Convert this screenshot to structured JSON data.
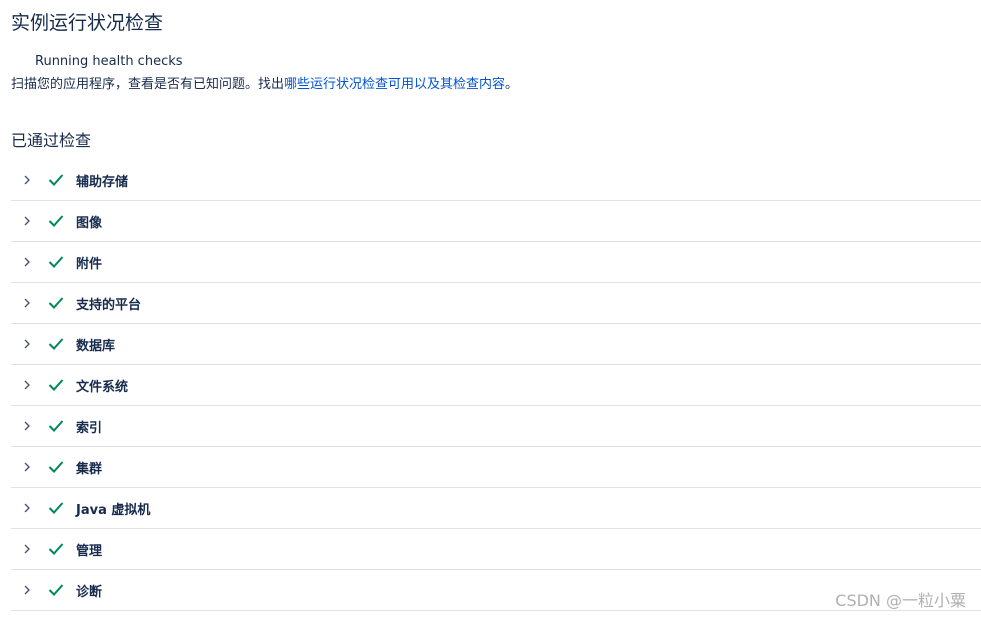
{
  "page": {
    "title": "实例运行状况检查",
    "running_text": "Running health checks",
    "description_prefix": "扫描您的应用程序，查看是否有已知问题。找出",
    "description_link": "哪些运行状况检查可用以及其检查内容",
    "description_suffix": "。"
  },
  "passed_section": {
    "title": "已通过检查",
    "items": [
      {
        "label": "辅助存储",
        "status": "passed"
      },
      {
        "label": "图像",
        "status": "passed"
      },
      {
        "label": "附件",
        "status": "passed"
      },
      {
        "label": "支持的平台",
        "status": "passed"
      },
      {
        "label": "数据库",
        "status": "passed"
      },
      {
        "label": "文件系统",
        "status": "passed"
      },
      {
        "label": "索引",
        "status": "passed"
      },
      {
        "label": "集群",
        "status": "passed"
      },
      {
        "label": "Java 虚拟机",
        "status": "passed"
      },
      {
        "label": "管理",
        "status": "passed"
      },
      {
        "label": "诊断",
        "status": "passed"
      }
    ]
  },
  "icons": {
    "expand": "chevron-right-icon",
    "status": "check-icon"
  },
  "colors": {
    "success": "#00875a",
    "link": "#0052cc",
    "text": "#172b4d",
    "divider": "#dfe1e6"
  },
  "watermark": "CSDN @一粒小粟"
}
